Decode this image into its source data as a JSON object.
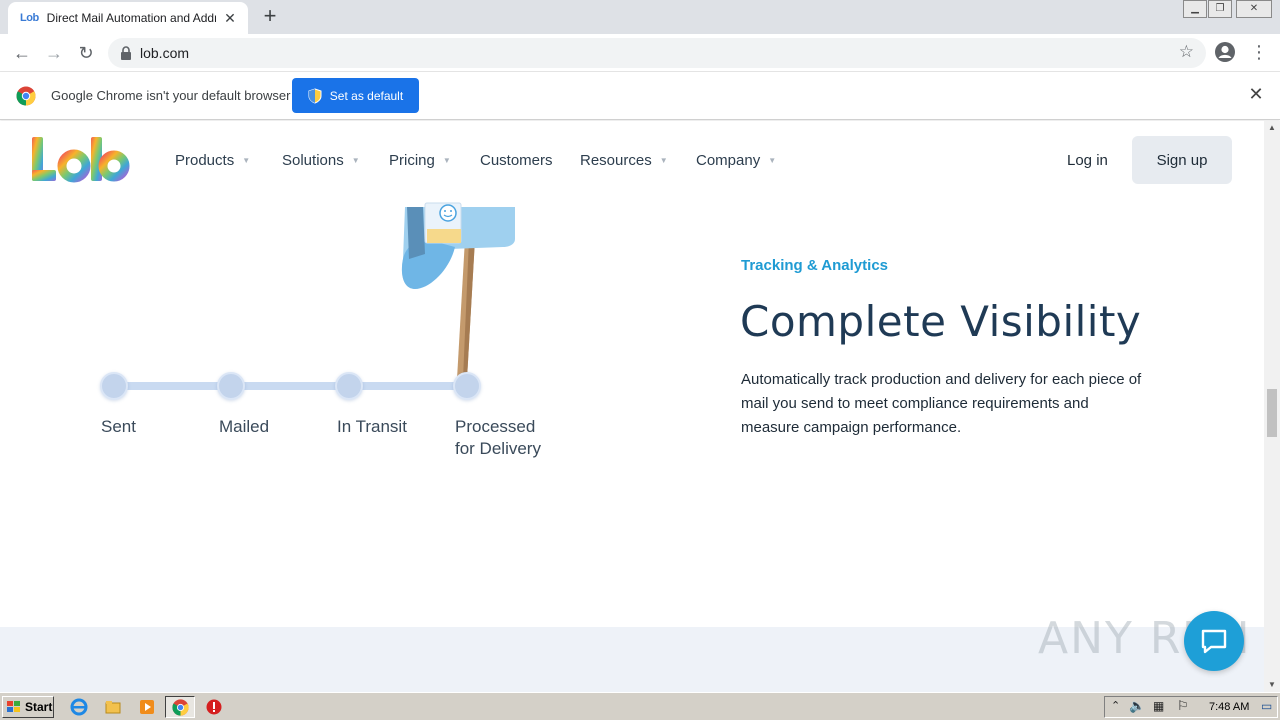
{
  "browser": {
    "tab": {
      "favicon_text": "Lob",
      "title": "Direct Mail Automation and Address"
    },
    "url": "lob.com"
  },
  "infobar": {
    "message": "Google Chrome isn't your default browser",
    "button_label": "Set as default"
  },
  "site": {
    "nav": {
      "items": [
        {
          "label": "Products"
        },
        {
          "label": "Solutions"
        },
        {
          "label": "Pricing"
        },
        {
          "label": "Customers"
        },
        {
          "label": "Resources"
        },
        {
          "label": "Company"
        }
      ],
      "login_label": "Log in",
      "signup_label": "Sign up"
    },
    "timeline": {
      "steps": [
        {
          "label": "Sent"
        },
        {
          "label": "Mailed"
        },
        {
          "label": "In Transit"
        },
        {
          "label_line1": "Processed",
          "label_line2": "for Delivery"
        }
      ]
    },
    "feature": {
      "eyebrow": "Tracking & Analytics",
      "headline": "Complete Visibility",
      "body": "Automatically track production and delivery for each piece of mail you send to meet compliance requirements and measure campaign performance."
    }
  },
  "watermark": "ANY RUN",
  "taskbar": {
    "start_label": "Start",
    "clock": "7:48 AM"
  },
  "colors": {
    "accent_blue": "#1a73e8",
    "eyebrow": "#1f9bd3",
    "headline": "#1f3a55",
    "chat": "#1e9fd7"
  }
}
